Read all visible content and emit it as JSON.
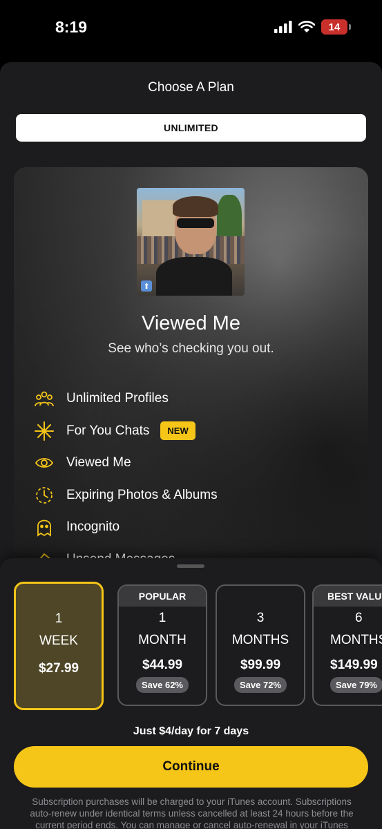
{
  "status_bar": {
    "time": "8:19",
    "battery": "14",
    "icons": [
      "signal-icon",
      "wifi-icon",
      "battery-icon"
    ]
  },
  "header": {
    "title": "Choose A Plan",
    "segment_label": "UNLIMITED"
  },
  "feature_card": {
    "title": "Viewed Me",
    "subtitle": "See who’s checking you out.",
    "features": [
      {
        "label": "Unlimited Profiles",
        "icon": "people-icon"
      },
      {
        "label": "For You Chats",
        "icon": "sparkle-icon",
        "badge": "NEW"
      },
      {
        "label": "Viewed Me",
        "icon": "eye-icon"
      },
      {
        "label": "Expiring Photos & Albums",
        "icon": "timer-icon"
      },
      {
        "label": "Incognito",
        "icon": "ghost-icon"
      },
      {
        "label": "Unsend Messages",
        "icon": "eraser-icon"
      }
    ]
  },
  "plans": [
    {
      "header": "",
      "number": "1",
      "unit": "WEEK",
      "price": "$27.99",
      "save": "",
      "selected": true
    },
    {
      "header": "POPULAR",
      "number": "1",
      "unit": "MONTH",
      "price": "$44.99",
      "save": "Save 62%"
    },
    {
      "header": "",
      "number": "3",
      "unit": "MONTHS",
      "price": "$99.99",
      "save": "Save 72%"
    },
    {
      "header": "BEST VALUE",
      "number": "6",
      "unit": "MONTHS",
      "price": "$149.99",
      "save": "Save 79%"
    }
  ],
  "tagline": "Just $4/day for 7 days",
  "continue_label": "Continue",
  "legal": "Subscription purchases will be charged to your iTunes account.  Subscriptions auto-renew under identical terms unless cancelled at least 24 hours before the current period ends.  You can manage or cancel auto-renewal in your iTunes",
  "colors": {
    "accent": "#f5c518",
    "sheet_bg": "#1c1c1e",
    "selected_plan_bg": "#4e4626"
  }
}
